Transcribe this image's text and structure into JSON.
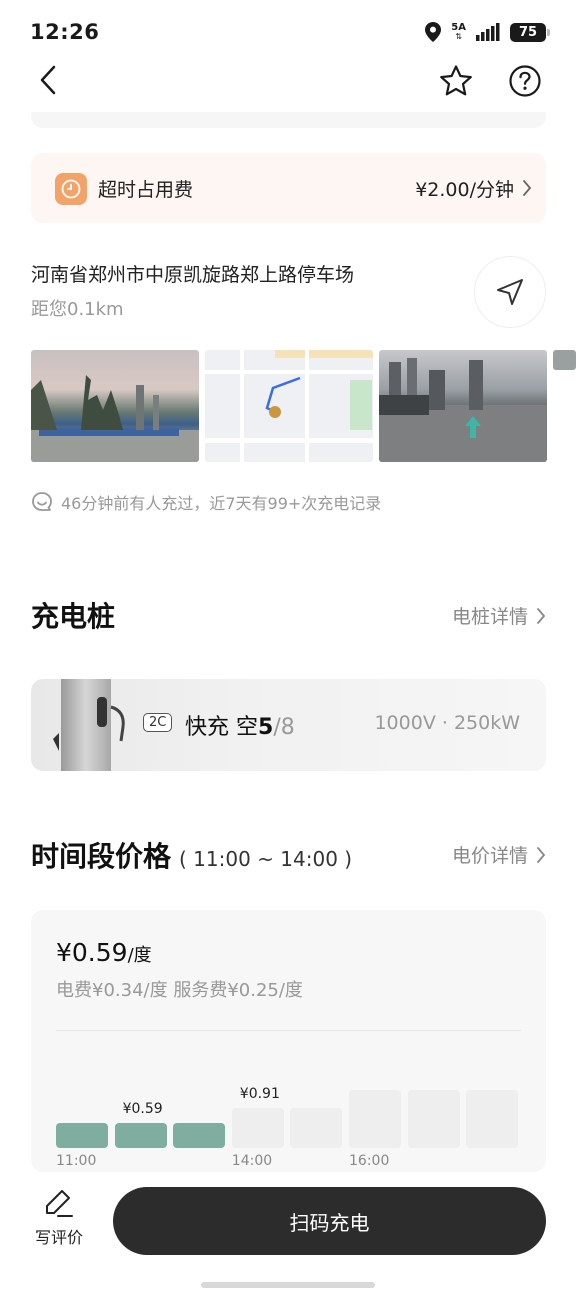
{
  "status_bar": {
    "time": "12:26",
    "network": "5A",
    "battery": "75"
  },
  "fee": {
    "label": "超时占用费",
    "value": "¥2.00/分钟"
  },
  "station": {
    "address": "河南省郑州市中原凯旋路郑上路停车场",
    "distance": "距您0.1km"
  },
  "recent_activity": "46分钟前有人充过，近7天有99+次充电记录",
  "piles_section": {
    "title": "充电桩",
    "link": "电桩详情",
    "item": {
      "badge": "2C",
      "type": "快充",
      "free_label": "空",
      "free_count": "5",
      "total": "/8",
      "spec": "1000V · 250kW"
    }
  },
  "price_section": {
    "title": "时间段价格",
    "period": "( 11:00 ~ 14:00 )",
    "link": "电价详情",
    "current_price": "¥0.59",
    "current_unit": "/度",
    "breakdown": "电费¥0.34/度 服务费¥0.25/度",
    "chart_data": {
      "type": "bar",
      "categories": [
        "11:00",
        "12:00",
        "13:00",
        "14:00",
        "15:00",
        "16:00",
        "17:00",
        "18:00"
      ],
      "values": [
        0.59,
        0.59,
        0.59,
        0.91,
        0.91,
        null,
        null,
        null
      ],
      "active": [
        true,
        true,
        true,
        false,
        false,
        false,
        false,
        false
      ],
      "annotations": [
        {
          "index": 1,
          "label": "¥0.59"
        },
        {
          "index": 3,
          "label": "¥0.91"
        }
      ],
      "tick_labels": [
        "11:00",
        "14:00",
        "16:00"
      ],
      "colors": {
        "active": "#7fada0",
        "inactive": "#eeeeee"
      }
    }
  },
  "bottom": {
    "review_label": "写评价",
    "scan_label": "扫码充电"
  }
}
